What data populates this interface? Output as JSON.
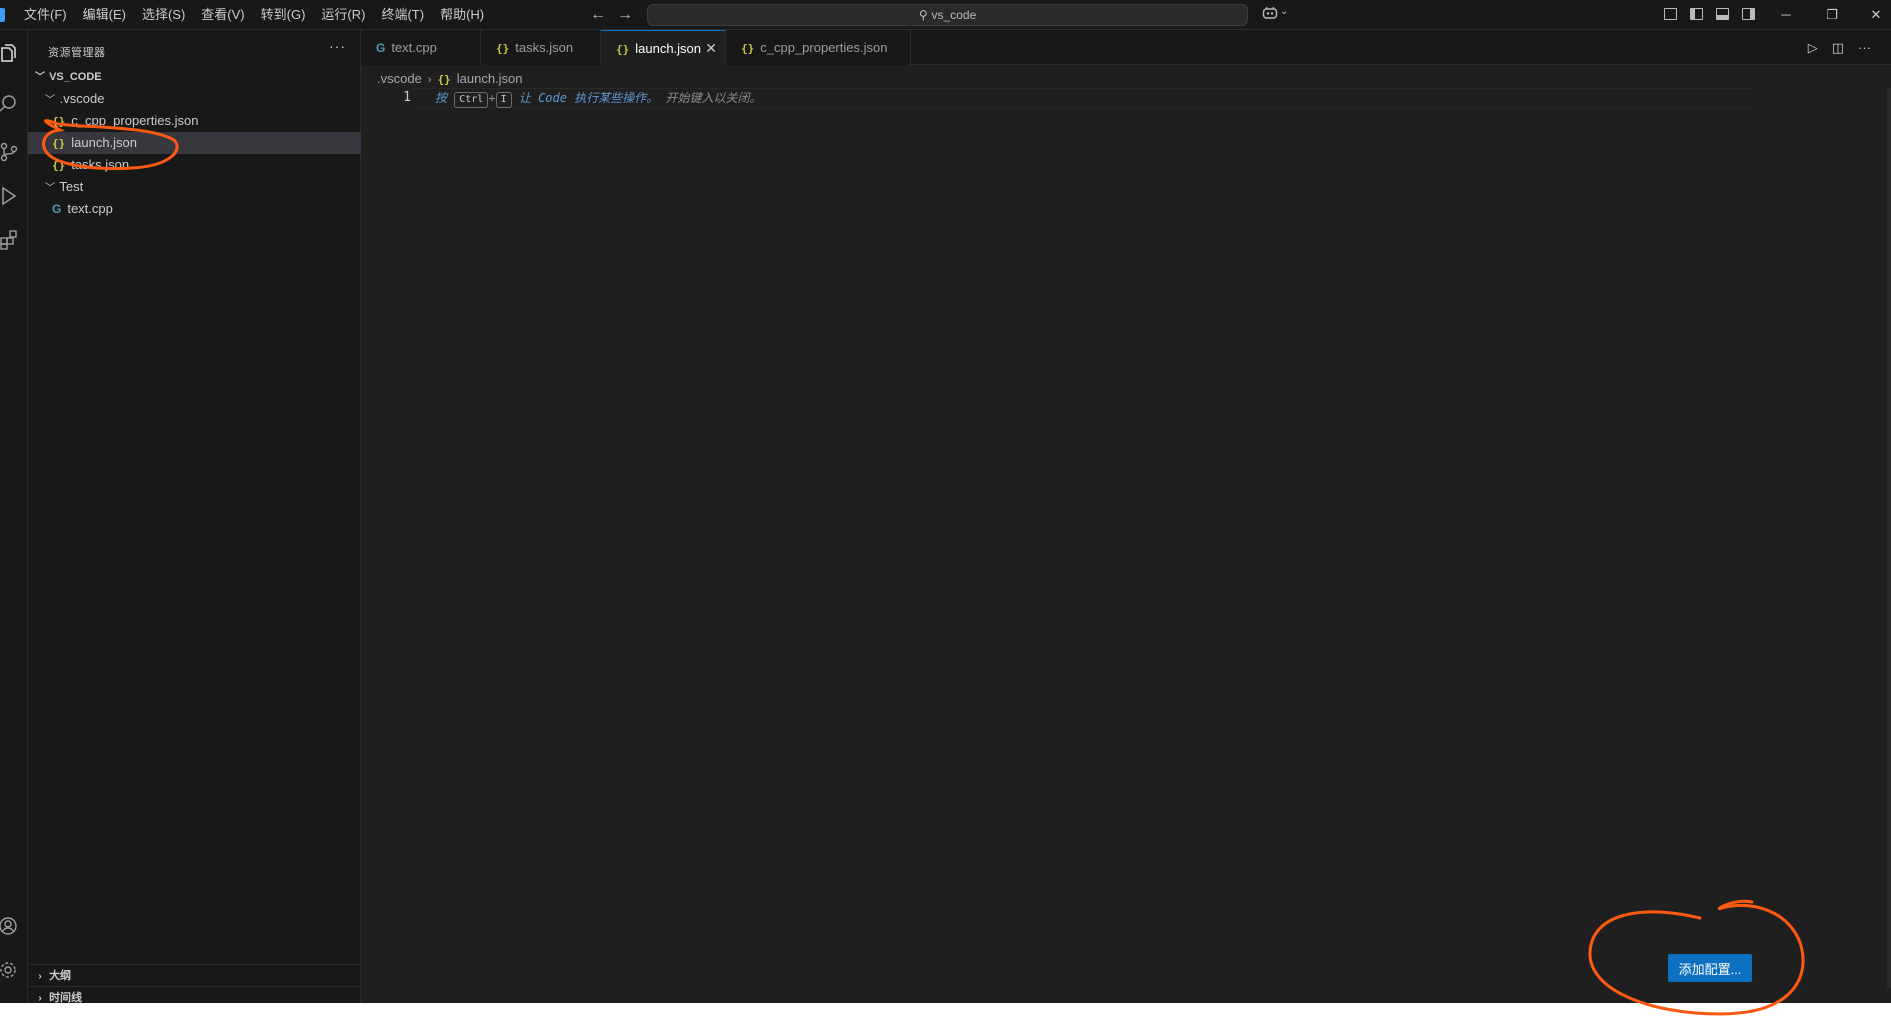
{
  "menu": [
    "文件(F)",
    "编辑(E)",
    "选择(S)",
    "查看(V)",
    "转到(G)",
    "运行(R)",
    "终端(T)",
    "帮助(H)"
  ],
  "search": {
    "text": "vs_code"
  },
  "explorer": {
    "title": "资源管理器",
    "more": "···",
    "root": "VS_CODE",
    "folder_vscode": ".vscode",
    "file_cpp_props": "c_cpp_properties.json",
    "file_launch": "launch.json",
    "file_tasks": "tasks.json",
    "folder_test": "Test",
    "file_text_cpp": "text.cpp",
    "outline": "大纲",
    "timeline": "时间线"
  },
  "tabs": {
    "t1": "text.cpp",
    "t2": "tasks.json",
    "t3": "launch.json",
    "t4": "c_cpp_properties.json"
  },
  "breadcrumb": {
    "folder": ".vscode",
    "file": "launch.json"
  },
  "editor": {
    "line_number": "1",
    "hint_prefix": "按",
    "key_ctrl": "Ctrl",
    "key_plus": "+",
    "key_i": "I",
    "hint_code": "让 Code 执行某些操作。",
    "hint_dismiss": "开始键入以关闭。"
  },
  "add_config_label": "添加配置...",
  "colors": {
    "accent": "#0078d4",
    "button": "#0e70c0",
    "annotation": "#ff5a12",
    "json_icon": "#cbcb41",
    "cpp_icon": "#519aba"
  }
}
